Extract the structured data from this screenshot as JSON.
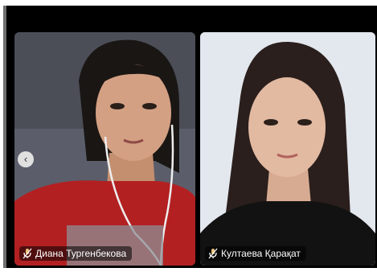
{
  "participants": [
    {
      "name": "Диана Тургенбекова",
      "mic_icon": "mic-muted-icon",
      "video_on": true
    },
    {
      "name": "Култаева Қарақат",
      "mic_icon": "mic-muted-icon",
      "video_on": true
    }
  ],
  "controls": {
    "prev_icon": "‹"
  },
  "colors": {
    "background": "#000000",
    "tag_background": "rgba(0,0,0,0.55)",
    "mic_accent": "#e9c27a"
  }
}
